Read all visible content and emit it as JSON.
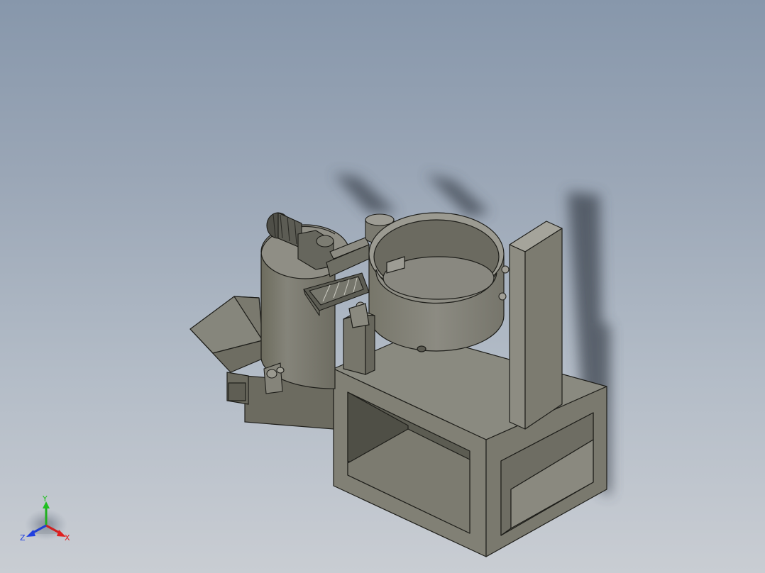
{
  "viewport": {
    "description": "",
    "background_top": "#8797ab",
    "background_bottom": "#c9cdd3"
  },
  "triad": {
    "x_label": "X",
    "y_label": "Y",
    "z_label": "Z",
    "x_color": "#e02020",
    "y_color": "#20c020",
    "z_color": "#2040e0"
  }
}
